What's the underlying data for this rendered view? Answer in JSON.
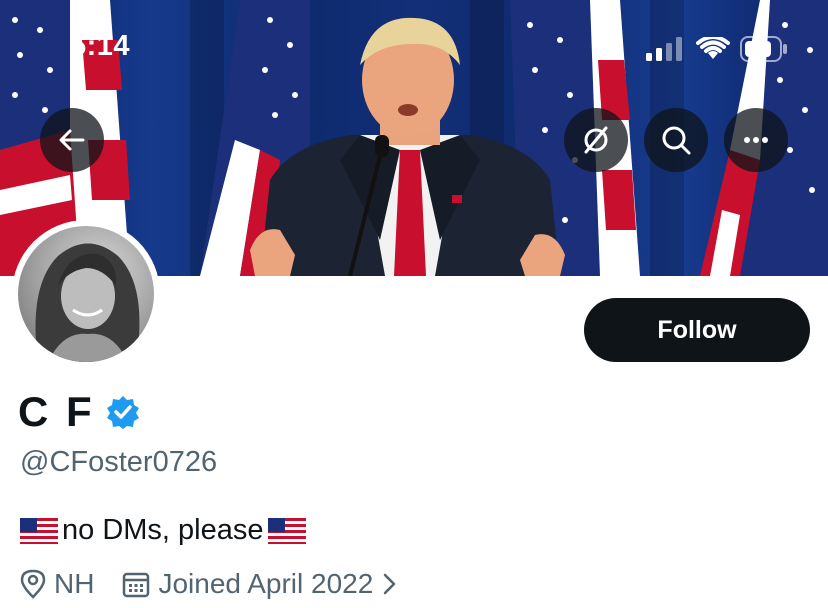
{
  "status_bar": {
    "time": "5:14"
  },
  "profile": {
    "name": "C F",
    "handle": "@CFoster0726",
    "verified": true,
    "bio_text": "no DMs, please",
    "location": "NH",
    "joined": "Joined April 2022"
  },
  "actions": {
    "follow_label": "Follow"
  },
  "icons": [
    "back-arrow-icon",
    "mute-icon",
    "search-icon",
    "more-icon",
    "verified-badge-icon",
    "location-pin-icon",
    "calendar-icon",
    "chevron-right-icon",
    "us-flag-icon",
    "signal-icon",
    "wifi-icon",
    "battery-icon"
  ],
  "colors": {
    "verified": "#1d9bf0",
    "follow_bg": "#0f1419",
    "secondary_text": "#536471"
  }
}
